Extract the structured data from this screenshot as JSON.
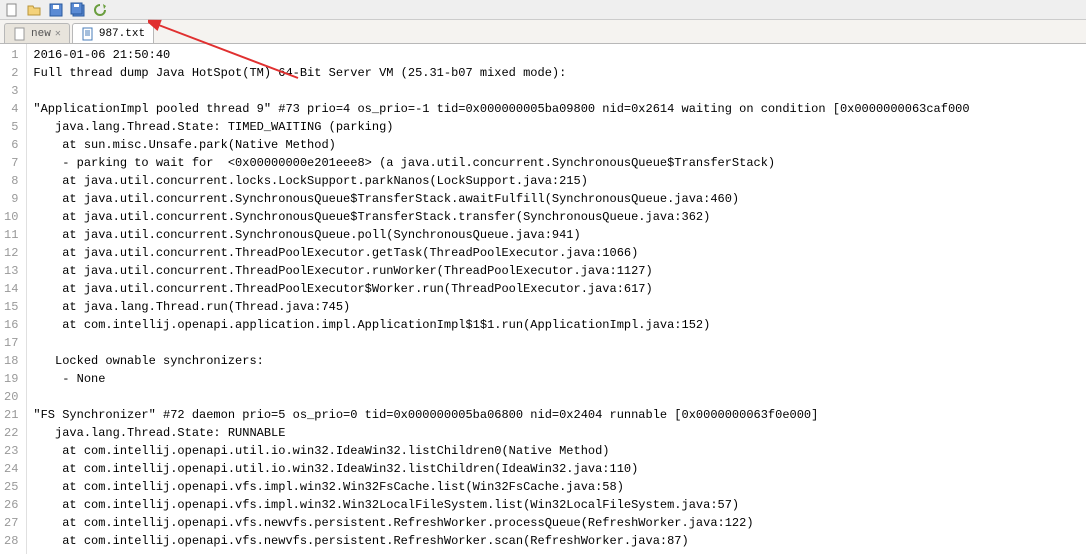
{
  "tabs": {
    "inactive": {
      "label": "new"
    },
    "active": {
      "label": "987.txt"
    }
  },
  "lines": [
    {
      "n": 1,
      "t": "2016-01-06 21:50:40"
    },
    {
      "n": 2,
      "t": "Full thread dump Java HotSpot(TM) 64-Bit Server VM (25.31-b07 mixed mode):"
    },
    {
      "n": 3,
      "t": ""
    },
    {
      "n": 4,
      "t": "\"ApplicationImpl pooled thread 9\" #73 prio=4 os_prio=-1 tid=0x000000005ba09800 nid=0x2614 waiting on condition [0x0000000063caf000"
    },
    {
      "n": 5,
      "t": "   java.lang.Thread.State: TIMED_WAITING (parking)"
    },
    {
      "n": 6,
      "t": "    at sun.misc.Unsafe.park(Native Method)"
    },
    {
      "n": 7,
      "t": "    - parking to wait for  <0x00000000e201eee8> (a java.util.concurrent.SynchronousQueue$TransferStack)"
    },
    {
      "n": 8,
      "t": "    at java.util.concurrent.locks.LockSupport.parkNanos(LockSupport.java:215)"
    },
    {
      "n": 9,
      "t": "    at java.util.concurrent.SynchronousQueue$TransferStack.awaitFulfill(SynchronousQueue.java:460)"
    },
    {
      "n": 10,
      "t": "    at java.util.concurrent.SynchronousQueue$TransferStack.transfer(SynchronousQueue.java:362)"
    },
    {
      "n": 11,
      "t": "    at java.util.concurrent.SynchronousQueue.poll(SynchronousQueue.java:941)"
    },
    {
      "n": 12,
      "t": "    at java.util.concurrent.ThreadPoolExecutor.getTask(ThreadPoolExecutor.java:1066)"
    },
    {
      "n": 13,
      "t": "    at java.util.concurrent.ThreadPoolExecutor.runWorker(ThreadPoolExecutor.java:1127)"
    },
    {
      "n": 14,
      "t": "    at java.util.concurrent.ThreadPoolExecutor$Worker.run(ThreadPoolExecutor.java:617)"
    },
    {
      "n": 15,
      "t": "    at java.lang.Thread.run(Thread.java:745)"
    },
    {
      "n": 16,
      "t": "    at com.intellij.openapi.application.impl.ApplicationImpl$1$1.run(ApplicationImpl.java:152)"
    },
    {
      "n": 17,
      "t": ""
    },
    {
      "n": 18,
      "t": "   Locked ownable synchronizers:"
    },
    {
      "n": 19,
      "t": "    - None"
    },
    {
      "n": 20,
      "t": ""
    },
    {
      "n": 21,
      "t": "\"FS Synchronizer\" #72 daemon prio=5 os_prio=0 tid=0x000000005ba06800 nid=0x2404 runnable [0x0000000063f0e000]"
    },
    {
      "n": 22,
      "t": "   java.lang.Thread.State: RUNNABLE"
    },
    {
      "n": 23,
      "t": "    at com.intellij.openapi.util.io.win32.IdeaWin32.listChildren0(Native Method)"
    },
    {
      "n": 24,
      "t": "    at com.intellij.openapi.util.io.win32.IdeaWin32.listChildren(IdeaWin32.java:110)"
    },
    {
      "n": 25,
      "t": "    at com.intellij.openapi.vfs.impl.win32.Win32FsCache.list(Win32FsCache.java:58)"
    },
    {
      "n": 26,
      "t": "    at com.intellij.openapi.vfs.impl.win32.Win32LocalFileSystem.list(Win32LocalFileSystem.java:57)"
    },
    {
      "n": 27,
      "t": "    at com.intellij.openapi.vfs.newvfs.persistent.RefreshWorker.processQueue(RefreshWorker.java:122)"
    },
    {
      "n": 28,
      "t": "    at com.intellij.openapi.vfs.newvfs.persistent.RefreshWorker.scan(RefreshWorker.java:87)"
    }
  ]
}
